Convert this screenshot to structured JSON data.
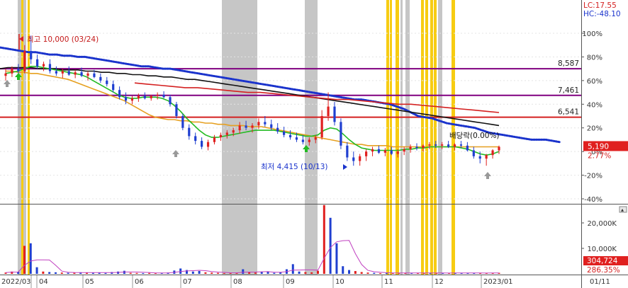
{
  "colors": {
    "up": "#e0201f",
    "down": "#1f3fd0",
    "ma_blue": "#1a33cc",
    "ma_black": "#111111",
    "ma_red": "#d42020",
    "ma_orange": "#e6a020",
    "ma_green": "#22bb22",
    "resistance": "#800080",
    "support": "#d42020",
    "band_gray": "#c6c6c6",
    "band_yellow": "#f7cc12",
    "tag_red": "#e0201f"
  },
  "header": {
    "lc_label": "LC:17.55",
    "hc_label": "HC:-48.10"
  },
  "chart_data": [
    {
      "type": "candlestick",
      "name": "price",
      "y_axis": {
        "unit": "percent",
        "ticks": [
          "100%",
          "80%",
          "60%",
          "40%",
          "20%",
          "0%",
          "-20%",
          "-40%"
        ],
        "tick_values": [
          100,
          80,
          60,
          40,
          20,
          0,
          -20,
          -40
        ],
        "ylim": [
          -48,
          110
        ]
      },
      "x_axis": {
        "ticks": [
          "2022/03",
          "04",
          "05",
          "06",
          "07",
          "08",
          "09",
          "10",
          "11",
          "12",
          "2023/01"
        ],
        "extra_tick": "01/11"
      },
      "horizontal_lines": [
        {
          "label": "8,587",
          "value": 70,
          "kind": "resistance"
        },
        {
          "label": "7,461",
          "value": 47.5,
          "kind": "resistance"
        },
        {
          "label": "6,541",
          "value": 29,
          "kind": "support"
        }
      ],
      "annotations": {
        "high": "최고 10,000 (03/24)",
        "low": "최저 4,415 (10/13)",
        "ex_dividend": "배당락(0.00%)"
      },
      "current": {
        "price_label": "5,190",
        "change_label": "2.77%",
        "value": 4
      },
      "candles": [
        {
          "o": 64,
          "h": 70,
          "l": 60,
          "c": 66
        },
        {
          "o": 66,
          "h": 72,
          "l": 63,
          "c": 70
        },
        {
          "o": 70,
          "h": 74,
          "l": 66,
          "c": 68
        },
        {
          "o": 68,
          "h": 90,
          "l": 66,
          "c": 85
        },
        {
          "o": 85,
          "h": 98,
          "l": 74,
          "c": 78
        },
        {
          "o": 78,
          "h": 82,
          "l": 70,
          "c": 72
        },
        {
          "o": 72,
          "h": 76,
          "l": 68,
          "c": 74
        },
        {
          "o": 74,
          "h": 78,
          "l": 66,
          "c": 68
        },
        {
          "o": 68,
          "h": 72,
          "l": 64,
          "c": 66
        },
        {
          "o": 66,
          "h": 70,
          "l": 62,
          "c": 68
        },
        {
          "o": 68,
          "h": 72,
          "l": 64,
          "c": 65
        },
        {
          "o": 65,
          "h": 69,
          "l": 62,
          "c": 67
        },
        {
          "o": 67,
          "h": 71,
          "l": 63,
          "c": 64
        },
        {
          "o": 64,
          "h": 68,
          "l": 60,
          "c": 66
        },
        {
          "o": 66,
          "h": 69,
          "l": 62,
          "c": 63
        },
        {
          "o": 63,
          "h": 66,
          "l": 58,
          "c": 60
        },
        {
          "o": 60,
          "h": 63,
          "l": 55,
          "c": 57
        },
        {
          "o": 57,
          "h": 60,
          "l": 50,
          "c": 52
        },
        {
          "o": 52,
          "h": 55,
          "l": 44,
          "c": 46
        },
        {
          "o": 46,
          "h": 50,
          "l": 40,
          "c": 43
        },
        {
          "o": 43,
          "h": 47,
          "l": 40,
          "c": 45
        },
        {
          "o": 45,
          "h": 49,
          "l": 42,
          "c": 47
        },
        {
          "o": 47,
          "h": 50,
          "l": 44,
          "c": 45
        },
        {
          "o": 45,
          "h": 48,
          "l": 43,
          "c": 47
        },
        {
          "o": 47,
          "h": 50,
          "l": 44,
          "c": 48
        },
        {
          "o": 48,
          "h": 51,
          "l": 45,
          "c": 46
        },
        {
          "o": 46,
          "h": 48,
          "l": 38,
          "c": 40
        },
        {
          "o": 40,
          "h": 42,
          "l": 28,
          "c": 30
        },
        {
          "o": 30,
          "h": 32,
          "l": 18,
          "c": 20
        },
        {
          "o": 20,
          "h": 23,
          "l": 10,
          "c": 13
        },
        {
          "o": 13,
          "h": 16,
          "l": 6,
          "c": 9
        },
        {
          "o": 9,
          "h": 12,
          "l": 2,
          "c": 4
        },
        {
          "o": 4,
          "h": 10,
          "l": 1,
          "c": 8
        },
        {
          "o": 8,
          "h": 14,
          "l": 6,
          "c": 12
        },
        {
          "o": 12,
          "h": 16,
          "l": 9,
          "c": 14
        },
        {
          "o": 14,
          "h": 18,
          "l": 11,
          "c": 16
        },
        {
          "o": 16,
          "h": 20,
          "l": 13,
          "c": 18
        },
        {
          "o": 18,
          "h": 25,
          "l": 15,
          "c": 22
        },
        {
          "o": 22,
          "h": 26,
          "l": 18,
          "c": 20
        },
        {
          "o": 20,
          "h": 24,
          "l": 16,
          "c": 22
        },
        {
          "o": 22,
          "h": 28,
          "l": 19,
          "c": 25
        },
        {
          "o": 25,
          "h": 30,
          "l": 21,
          "c": 23
        },
        {
          "o": 23,
          "h": 27,
          "l": 18,
          "c": 20
        },
        {
          "o": 20,
          "h": 24,
          "l": 15,
          "c": 17
        },
        {
          "o": 17,
          "h": 21,
          "l": 12,
          "c": 14
        },
        {
          "o": 14,
          "h": 18,
          "l": 10,
          "c": 12
        },
        {
          "o": 12,
          "h": 16,
          "l": 8,
          "c": 10
        },
        {
          "o": 10,
          "h": 14,
          "l": 6,
          "c": 8
        },
        {
          "o": 8,
          "h": 12,
          "l": 5,
          "c": 10
        },
        {
          "o": 10,
          "h": 14,
          "l": 7,
          "c": 12
        },
        {
          "o": 12,
          "h": 35,
          "l": 10,
          "c": 30
        },
        {
          "o": 30,
          "h": 50,
          "l": 26,
          "c": 38
        },
        {
          "o": 38,
          "h": 42,
          "l": 22,
          "c": 25
        },
        {
          "o": 25,
          "h": 28,
          "l": 2,
          "c": 5
        },
        {
          "o": 5,
          "h": 8,
          "l": -8,
          "c": -5
        },
        {
          "o": -5,
          "h": 0,
          "l": -12,
          "c": -8
        },
        {
          "o": -8,
          "h": -2,
          "l": -12,
          "c": -4
        },
        {
          "o": -4,
          "h": 2,
          "l": -8,
          "c": 0
        },
        {
          "o": 0,
          "h": 4,
          "l": -4,
          "c": 2
        },
        {
          "o": 2,
          "h": 5,
          "l": -2,
          "c": -1
        },
        {
          "o": -1,
          "h": 3,
          "l": -4,
          "c": 1
        },
        {
          "o": 1,
          "h": 4,
          "l": -3,
          "c": -2
        },
        {
          "o": -2,
          "h": 2,
          "l": -5,
          "c": 0
        },
        {
          "o": 0,
          "h": 4,
          "l": -3,
          "c": 2
        },
        {
          "o": 2,
          "h": 6,
          "l": -1,
          "c": 4
        },
        {
          "o": 4,
          "h": 7,
          "l": 1,
          "c": 3
        },
        {
          "o": 3,
          "h": 6,
          "l": 0,
          "c": 5
        },
        {
          "o": 5,
          "h": 8,
          "l": 2,
          "c": 6
        },
        {
          "o": 6,
          "h": 9,
          "l": 3,
          "c": 5
        },
        {
          "o": 5,
          "h": 8,
          "l": 2,
          "c": 6
        },
        {
          "o": 6,
          "h": 9,
          "l": 3,
          "c": 4
        },
        {
          "o": 4,
          "h": 7,
          "l": 1,
          "c": 6
        },
        {
          "o": 6,
          "h": 9,
          "l": 3,
          "c": 5
        },
        {
          "o": 5,
          "h": 8,
          "l": 0,
          "c": 1
        },
        {
          "o": 1,
          "h": 4,
          "l": -6,
          "c": -4
        },
        {
          "o": -4,
          "h": 0,
          "l": -10,
          "c": -6
        },
        {
          "o": -6,
          "h": -2,
          "l": -12,
          "c": -3
        },
        {
          "o": -3,
          "h": 2,
          "l": -6,
          "c": 1
        },
        {
          "o": 1,
          "h": 5,
          "l": -2,
          "c": 4
        }
      ],
      "moving_averages": [
        {
          "color_key": "ma_blue",
          "style": "dotted",
          "values": [
            88,
            87,
            86,
            85,
            84,
            84,
            83,
            82,
            82,
            81,
            81,
            80,
            80,
            79,
            78,
            77,
            76,
            75,
            74,
            73,
            72,
            72,
            71,
            70,
            70,
            69,
            68,
            67,
            66,
            65,
            64,
            63,
            62,
            61,
            60,
            59,
            58,
            57,
            56,
            55,
            54,
            53,
            52,
            51,
            50,
            49,
            48,
            47,
            46,
            45,
            44,
            44,
            43,
            42,
            41,
            40,
            38,
            36,
            33,
            30,
            29,
            28,
            26,
            24,
            23,
            22,
            21,
            20,
            18,
            16,
            15,
            14,
            13,
            12,
            11,
            10,
            10,
            10,
            9,
            8
          ]
        },
        {
          "color_key": "ma_black",
          "style": "solid",
          "values": [
            70,
            71,
            71,
            71,
            71,
            70,
            70,
            70,
            69,
            69,
            69,
            68,
            68,
            67,
            67,
            66,
            66,
            65,
            65,
            64,
            64,
            63,
            63,
            62,
            61,
            61,
            60,
            59,
            58,
            57,
            56,
            55,
            54,
            53,
            52,
            51,
            50,
            49,
            48,
            47,
            46,
            45,
            44,
            43,
            42,
            41,
            40,
            39,
            38,
            37,
            36,
            35,
            34,
            33,
            32,
            31,
            30,
            29,
            28,
            27,
            26,
            25,
            24,
            23,
            22
          ]
        },
        {
          "color_key": "ma_red",
          "style": "solid",
          "values": [
            58,
            57,
            56,
            55,
            54,
            54,
            53,
            52,
            51,
            50,
            50,
            49,
            48,
            47,
            46,
            45,
            44,
            44,
            43,
            42,
            41,
            40,
            40,
            39,
            38,
            37,
            36,
            35,
            34,
            33
          ]
        },
        {
          "color_key": "ma_orange",
          "style": "solid",
          "values": [
            68,
            68,
            67,
            67,
            66,
            66,
            65,
            64,
            63,
            62,
            61,
            59,
            57,
            55,
            53,
            51,
            49,
            47,
            45,
            43,
            40,
            37,
            34,
            31,
            29,
            28,
            27,
            27,
            26,
            26,
            25,
            25,
            24,
            24,
            23,
            23,
            22,
            22,
            22,
            21,
            21,
            21,
            20,
            19,
            18,
            17,
            16,
            15,
            14,
            13,
            12,
            11,
            10,
            9,
            8,
            7,
            6,
            6,
            5,
            5,
            5,
            5,
            4,
            4,
            4,
            4,
            4,
            4,
            4,
            4,
            4,
            4,
            4,
            4,
            4,
            4,
            4,
            4,
            4,
            4
          ]
        },
        {
          "color_key": "ma_green",
          "style": "solid",
          "values": [
            66,
            67,
            68,
            70,
            72,
            72,
            71,
            70,
            69,
            68,
            67,
            66,
            65,
            63,
            60,
            57,
            54,
            51,
            48,
            46,
            45,
            45,
            46,
            46,
            46,
            45,
            43,
            39,
            34,
            28,
            23,
            18,
            14,
            12,
            12,
            13,
            14,
            15,
            16,
            17,
            18,
            18,
            18,
            18,
            17,
            16,
            15,
            14,
            13,
            13,
            14,
            18,
            20,
            19,
            15,
            10,
            6,
            3,
            2,
            1,
            1,
            1,
            1,
            1,
            2,
            2,
            3,
            3,
            4,
            4,
            4,
            4,
            4,
            3,
            2,
            0,
            -2,
            -3,
            -2,
            0
          ]
        }
      ]
    },
    {
      "type": "bar",
      "name": "volume",
      "y_axis": {
        "ticks": [
          "20,000K",
          "10,000K"
        ],
        "tick_values": [
          20000,
          10000
        ],
        "ylim": [
          0,
          27000
        ]
      },
      "current": {
        "volume_label": "304,724",
        "ratio_label": "286.35%"
      },
      "values": [
        500,
        900,
        800,
        11000,
        12000,
        2600,
        900,
        700,
        600,
        500,
        400,
        400,
        600,
        500,
        400,
        450,
        350,
        700,
        900,
        1200,
        400,
        350,
        300,
        350,
        400,
        300,
        500,
        1300,
        2100,
        1500,
        900,
        1100,
        600,
        500,
        400,
        300,
        350,
        400,
        1800,
        600,
        500,
        700,
        800,
        400,
        600,
        1800,
        3800,
        900,
        700,
        600,
        1200,
        27000,
        22000,
        12000,
        3000,
        1500,
        1100,
        700,
        500,
        400,
        300,
        350,
        300,
        300,
        350,
        300,
        400,
        300,
        300,
        350,
        300,
        300,
        350,
        300,
        350,
        300,
        300,
        300,
        350,
        400
      ]
    }
  ]
}
